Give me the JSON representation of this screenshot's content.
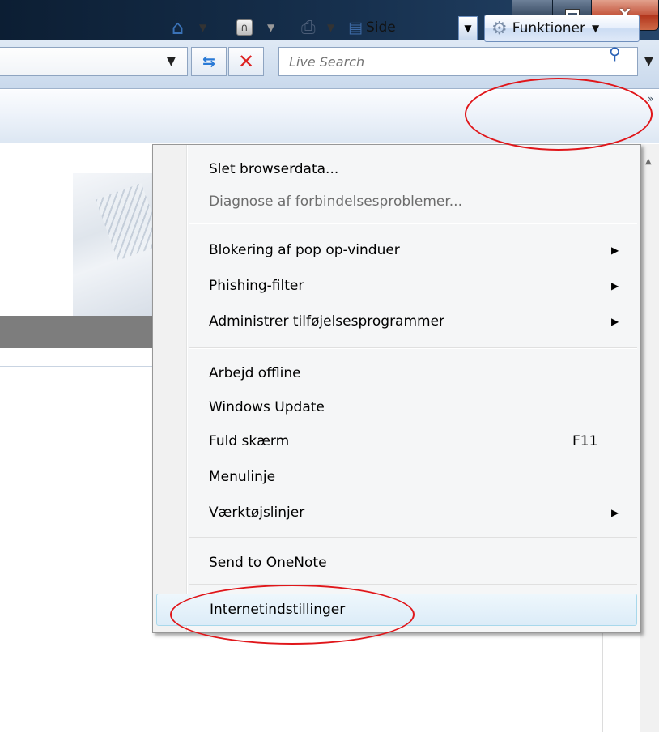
{
  "window": {
    "caption_buttons": {
      "minimize_icon": "minimize-icon",
      "maximize_icon": "maximize-icon",
      "close_label": "X"
    }
  },
  "address_bar": {
    "dropdown_icon": "chevron-down-icon",
    "refresh_icon": "refresh-arrows-icon",
    "stop_icon": "stop-x-icon",
    "search_placeholder": "Live Search",
    "search_icon": "magnifier-icon"
  },
  "command_bar": {
    "home_icon": "home-icon",
    "feeds_icon": "rss-feed-icon",
    "print_icon": "printer-icon",
    "page_icon": "page-icon",
    "page_label": "Side",
    "tools_label": "Funktioner",
    "tools_icon": "gear-icon"
  },
  "tools_menu": {
    "groups": [
      [
        {
          "label": "Slet browserdata...",
          "enabled": true
        },
        {
          "label": "Diagnose af forbindelsesproblemer...",
          "enabled": false
        }
      ],
      [
        {
          "label": "Blokering af pop op-vinduer",
          "submenu": true
        },
        {
          "label": "Phishing-filter",
          "submenu": true
        },
        {
          "label": "Administrer tilføjelsesprogrammer",
          "submenu": true
        }
      ],
      [
        {
          "label": "Arbejd offline"
        },
        {
          "label": "Windows Update"
        },
        {
          "label": "Fuld skærm",
          "shortcut": "F11"
        },
        {
          "label": "Menulinje"
        },
        {
          "label": "Værktøjslinjer",
          "submenu": true
        }
      ],
      [
        {
          "label": "Send to OneNote"
        }
      ],
      [
        {
          "label": "Internetindstillinger",
          "highlighted": true
        }
      ]
    ]
  },
  "colors": {
    "annotation_red": "#e0161a",
    "hover_border": "#a8d8eb",
    "disabled_text": "#6d6d6d"
  }
}
